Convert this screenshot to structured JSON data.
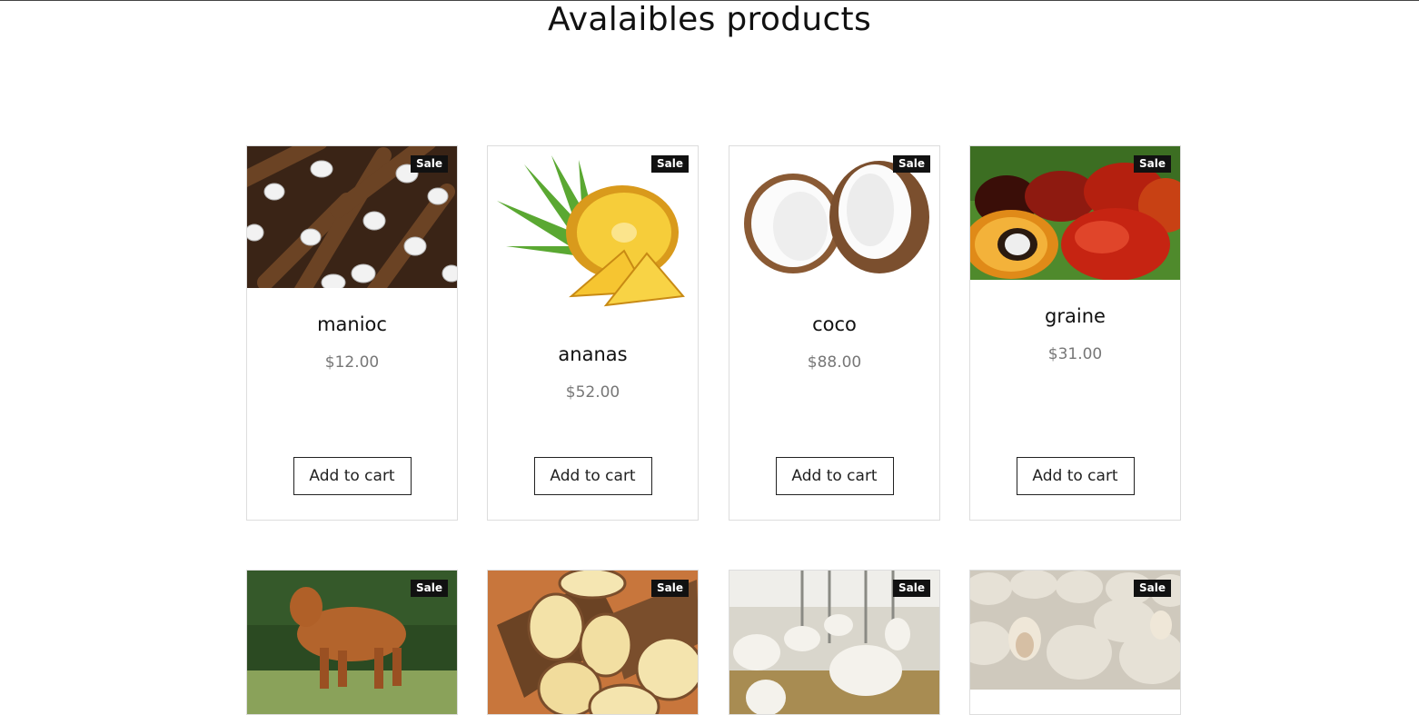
{
  "page": {
    "title": "Avalaibles products"
  },
  "badge_label": "Sale",
  "button_label": "Add to cart",
  "products": [
    {
      "name": "manioc",
      "price": "$12.00",
      "image": "cassava-roots"
    },
    {
      "name": "ananas",
      "price": "$52.00",
      "image": "pineapple"
    },
    {
      "name": "coco",
      "price": "$88.00",
      "image": "coconut"
    },
    {
      "name": "graine",
      "price": "$31.00",
      "image": "palm-fruit"
    },
    {
      "name": "",
      "price": "",
      "image": "cow"
    },
    {
      "name": "",
      "price": "",
      "image": "yam"
    },
    {
      "name": "",
      "price": "",
      "image": "goats"
    },
    {
      "name": "",
      "price": "",
      "image": "sheep"
    }
  ]
}
